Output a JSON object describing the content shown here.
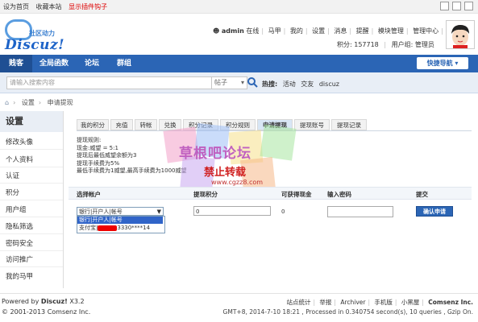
{
  "topbar": {
    "links": [
      "设为首页",
      "收藏本站"
    ],
    "highlight_link": "显示插件钩子"
  },
  "logo": {
    "sub": "社区动力",
    "main": "Discuz!"
  },
  "user": {
    "name": "admin",
    "status": "在线",
    "menu": [
      "马甲",
      "我的",
      "设置",
      "消息",
      "提醒",
      "模块管理",
      "管理中心",
      "退出"
    ],
    "points_label": "积分: 157718",
    "group_label": "用户组: 管理员"
  },
  "nav": {
    "items": [
      "贱客",
      "全局函数",
      "论坛",
      "群组"
    ],
    "quick_nav": "快捷导航"
  },
  "search": {
    "placeholder": "请输入搜索内容",
    "type": "帖子",
    "hot_label": "热搜:",
    "hot_terms": [
      "活动",
      "交友",
      "discuz"
    ]
  },
  "breadcrumb": [
    "设置",
    "申请提现"
  ],
  "sidebar": {
    "title": "设置",
    "items": [
      "修改头像",
      "个人资料",
      "认证",
      "积分",
      "用户组",
      "隐私筛选",
      "密码安全",
      "访问推广",
      "我的马甲"
    ]
  },
  "tabs": [
    "我的积分",
    "充值",
    "转帐",
    "兑换",
    "积分记录",
    "积分规则",
    "申请提现",
    "提现账号",
    "提现记录"
  ],
  "active_tab": 6,
  "rules": {
    "title": "提现规则:",
    "lines": [
      "现金:威望 = 5:1",
      "提现后最低威望余额为3",
      "提现手续费为5%",
      "最低手续费为1威望,最高手续费为1000威望"
    ]
  },
  "form": {
    "headers": [
      "选择帐户",
      "提现积分",
      "可获得现金",
      "输入密码",
      "提交"
    ],
    "account_selected": "银行|开户人|帐号",
    "options": [
      "银行|开户人|帐号",
      "支付宝|"
    ],
    "option2_suffix": "3330****14",
    "amount_value": "0",
    "available_value": "0",
    "submit_label": "确认申请"
  },
  "watermark": {
    "title": "草根吧论坛",
    "subtitle": "禁止转载",
    "url": "www.cgzz8.com"
  },
  "footer": {
    "powered": "Powered by ",
    "brand": "Discuz!",
    "version": " X3.2",
    "copyright": "© 2001-2013 Comsenz Inc.",
    "links": [
      "站点统计",
      "举报",
      "Archiver",
      "手机版",
      "小黑屋"
    ],
    "company": "Comsenz Inc.",
    "debug": "GMT+8, 2014-7-10 18:21 , Processed in 0.340754 second(s), 10 queries , Gzip On."
  },
  "colors": {
    "nav_bg": "#2b65b5",
    "accent": "#1d63c8",
    "highlight": "#d00000"
  }
}
